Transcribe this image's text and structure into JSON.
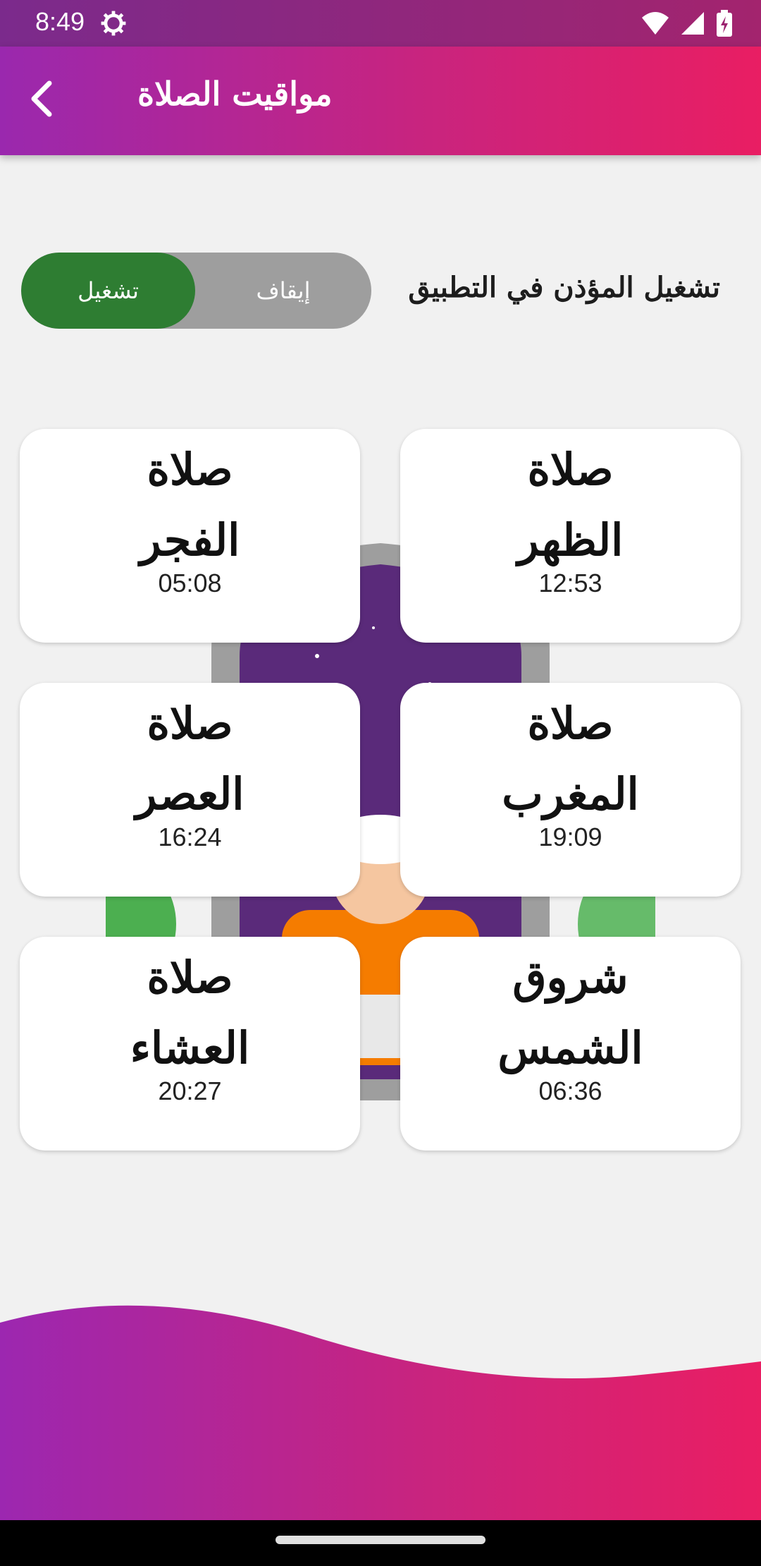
{
  "status_bar": {
    "time": "8:49"
  },
  "header": {
    "title": "مواقيت الصلاة"
  },
  "adhan_toggle": {
    "label": "تشغيل المؤذن في التطبيق",
    "on_label": "تشغيل",
    "off_label": "إيقاف",
    "selected": "on"
  },
  "prayers": [
    {
      "line1": "صلاة",
      "line2": "الفجر",
      "time": "05:08"
    },
    {
      "line1": "صلاة",
      "line2": "الظهر",
      "time": "12:53"
    },
    {
      "line1": "صلاة",
      "line2": "العصر",
      "time": "16:24"
    },
    {
      "line1": "صلاة",
      "line2": "المغرب",
      "time": "19:09"
    },
    {
      "line1": "صلاة",
      "line2": "العشاء",
      "time": "20:27"
    },
    {
      "line1": "شروق",
      "line2": "الشمس",
      "time": "06:36"
    }
  ],
  "colors": {
    "gradient_start": "#9a28ae",
    "gradient_end": "#e91e63",
    "toggle_on": "#2e7d32",
    "toggle_off": "#9e9e9e"
  }
}
